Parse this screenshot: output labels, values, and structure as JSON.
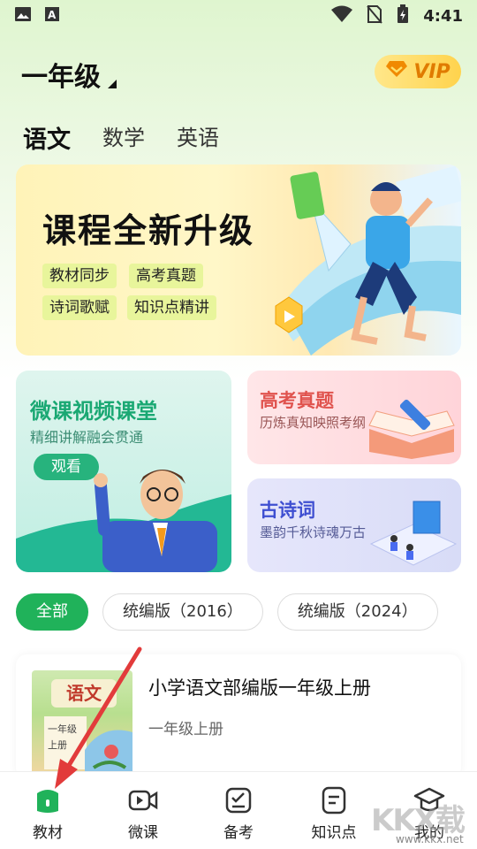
{
  "status_bar": {
    "time": "4:41"
  },
  "header": {
    "grade": "一年级",
    "vip_label": "VIP"
  },
  "subject_tabs": [
    {
      "label": "语文",
      "active": true
    },
    {
      "label": "数学",
      "active": false
    },
    {
      "label": "英语",
      "active": false
    }
  ],
  "banner": {
    "title": "课程全新升级",
    "chips": [
      "教材同步",
      "高考真题",
      "诗词歌赋",
      "知识点精讲"
    ]
  },
  "cards": {
    "micro": {
      "title": "微课视频课堂",
      "subtitle": "精细讲解融会贯通",
      "button": "观看"
    },
    "exam": {
      "title": "高考真题",
      "subtitle": "历炼真知映照考纲"
    },
    "poetry": {
      "title": "古诗词",
      "subtitle": "墨韵千秋诗魂万古"
    }
  },
  "filters": [
    "全部",
    "统编版（2016）",
    "统编版（2024）"
  ],
  "book": {
    "title": "小学语文部编版一年级上册",
    "subtitle": "一年级上册",
    "cover_text": "语文",
    "cover_sub": "一年级",
    "cover_sub2": "上册"
  },
  "bottom_nav": [
    {
      "label": "教材",
      "icon": "textbook-icon",
      "active": true
    },
    {
      "label": "微课",
      "icon": "video-icon",
      "active": false
    },
    {
      "label": "备考",
      "icon": "checklist-icon",
      "active": false
    },
    {
      "label": "知识点",
      "icon": "notes-icon",
      "active": false
    },
    {
      "label": "我的",
      "icon": "graduation-cap-icon",
      "active": false
    }
  ],
  "watermark": {
    "text": "KKX载",
    "url_text": "www.kkx.net"
  },
  "colors": {
    "accent": "#20b25a",
    "vip": "#ffd34d"
  }
}
